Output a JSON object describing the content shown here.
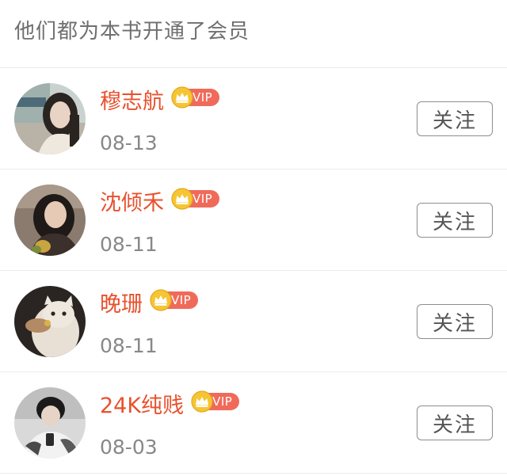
{
  "section": {
    "title": "他们都为本书开通了会员"
  },
  "members": [
    {
      "name": "穆志航",
      "badge": "VIP",
      "date": "08-13",
      "follow_label": "关注"
    },
    {
      "name": "沈倾禾",
      "badge": "VIP",
      "date": "08-11",
      "follow_label": "关注"
    },
    {
      "name": "晚珊",
      "badge": "VIP",
      "date": "08-11",
      "follow_label": "关注"
    },
    {
      "name": "24K纯贱",
      "badge": "VIP",
      "date": "08-03",
      "follow_label": "关注"
    }
  ],
  "colors": {
    "name_color": "#e8512d",
    "vip_badge_bg": "#f06a5a",
    "crown_gold": "#f5c533",
    "date_color": "#888888",
    "divider": "#ececec"
  },
  "icons": {
    "crown": "crown-icon"
  }
}
